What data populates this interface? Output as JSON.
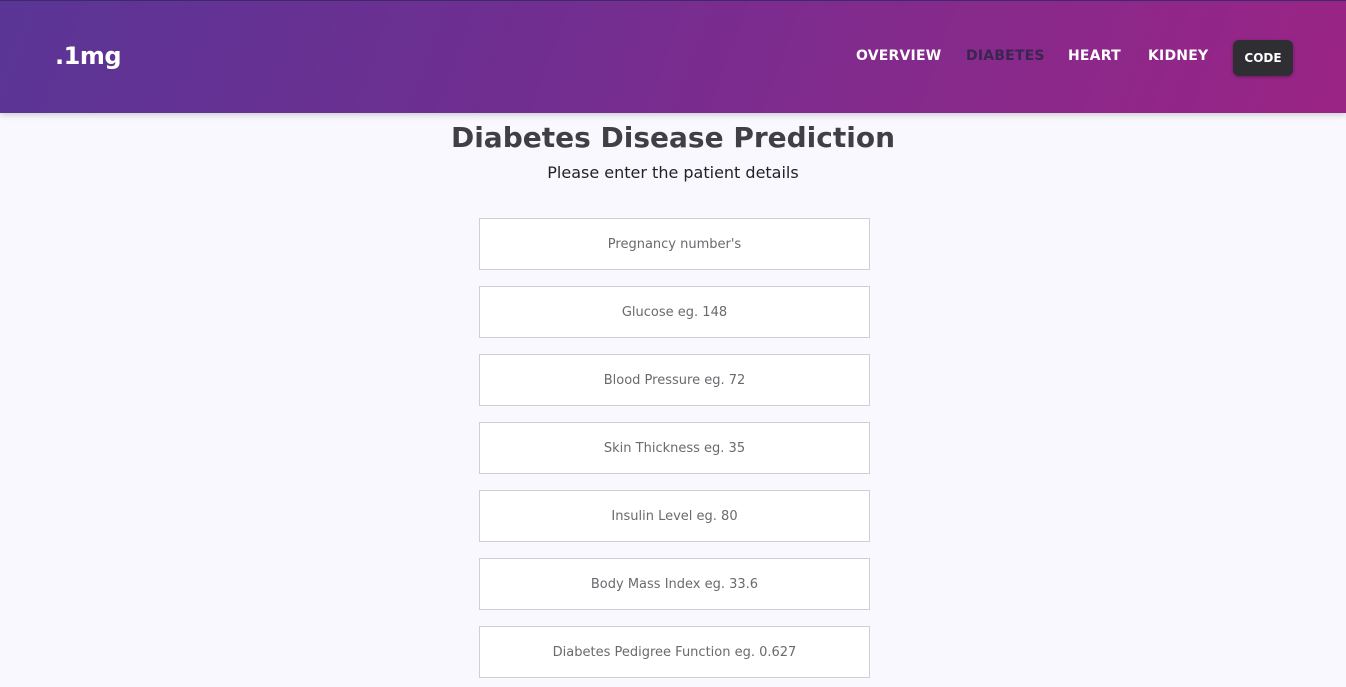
{
  "nav": {
    "logo": ".1mg",
    "links": [
      {
        "label": "OVERVIEW",
        "active": false
      },
      {
        "label": "DIABETES",
        "active": true
      },
      {
        "label": "HEART",
        "active": false
      },
      {
        "label": "KIDNEY",
        "active": false
      }
    ],
    "code_button": "CODE"
  },
  "main": {
    "title": "Diabetes Disease Prediction",
    "subtitle": "Please enter the patient details",
    "fields": [
      {
        "placeholder": "Pregnancy number's",
        "value": ""
      },
      {
        "placeholder": "Glucose eg. 148",
        "value": ""
      },
      {
        "placeholder": "Blood Pressure eg. 72",
        "value": ""
      },
      {
        "placeholder": "Skin Thickness eg. 35",
        "value": ""
      },
      {
        "placeholder": "Insulin Level eg. 80",
        "value": ""
      },
      {
        "placeholder": "Body Mass Index eg. 33.6",
        "value": ""
      },
      {
        "placeholder": "Diabetes Pedigree Function eg. 0.627",
        "value": ""
      }
    ]
  },
  "colors": {
    "nav_gradient_start": "#5a3596",
    "nav_gradient_end": "#9a2485",
    "active_link": "#3a2550",
    "code_button_bg": "#2f2f33",
    "page_bg": "#f8f8fe"
  }
}
